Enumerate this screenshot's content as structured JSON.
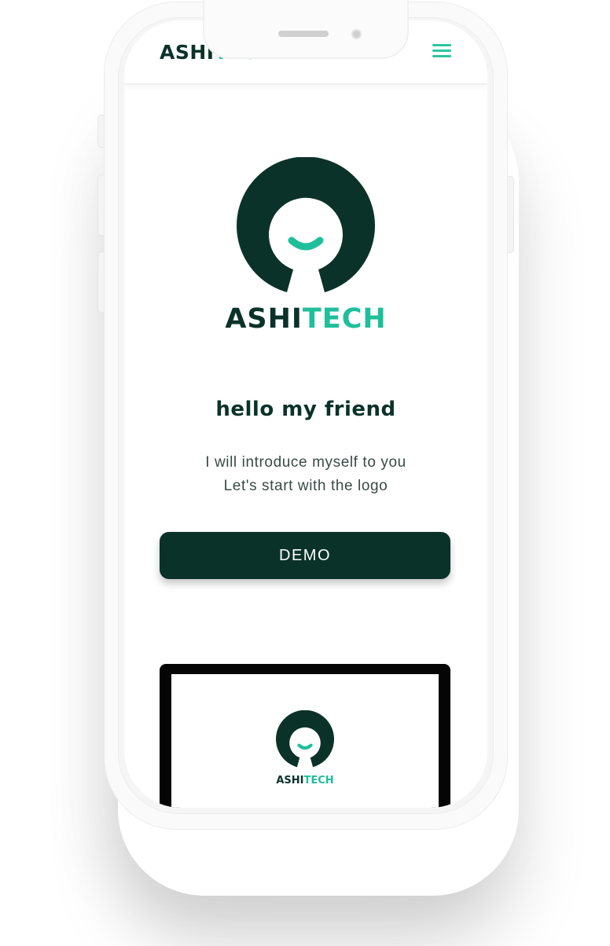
{
  "colors": {
    "brand_dark": "#0b3229",
    "brand_accent": "#1fbf9b",
    "button_text": "#ffffff"
  },
  "navbar": {
    "brand_part1": "ASHI",
    "brand_part2": "TECH",
    "menu_icon": "hamburger-menu-icon"
  },
  "hero": {
    "logo_icon": "ashitech-logo-mark",
    "logo_part1": "ASHI",
    "logo_part2": "TECH",
    "headline": "hello my friend",
    "intro_line1": "I will introduce myself to you",
    "intro_line2": "Let's start with the logo",
    "demo_button": "DEMO"
  },
  "preview": {
    "logo_part1": "ASHI",
    "logo_part2": "TECH"
  }
}
